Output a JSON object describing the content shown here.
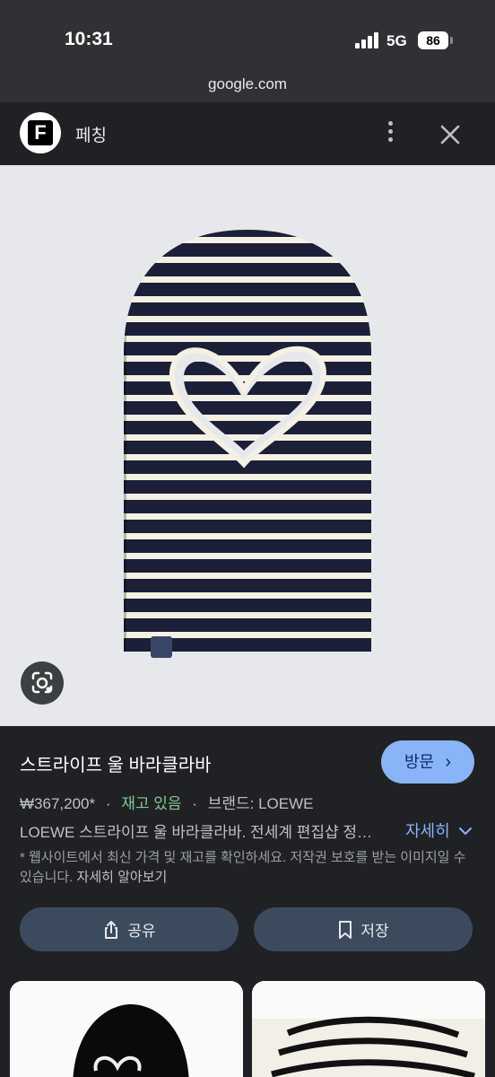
{
  "status_bar": {
    "time": "10:31",
    "network": "5G",
    "battery": "86"
  },
  "url_bar": {
    "domain": "google.com"
  },
  "header": {
    "site_logo_letter": "F",
    "site_name": "페칭"
  },
  "product": {
    "title": "스트라이프 울 바라클라바",
    "visit_label": "방문",
    "price": "₩367,200*",
    "stock": "재고 있음",
    "brand": "브랜드: LOEWE",
    "description": "LOEWE 스트라이프 울 바라클라바. 전세계 편집샵 정…",
    "more_label": "자세히",
    "notice": "* 웹사이트에서 최신 가격 및 재고를 확인하세요. 저작권 보호를 받는 이미지일 수 있습니다.",
    "learn_more": "자세히 알아보기"
  },
  "actions": {
    "share_label": "공유",
    "save_label": "저장"
  },
  "icons": [
    "more-vert-icon",
    "close-icon",
    "google-lens-icon",
    "chevron-right-icon",
    "chevron-down-icon",
    "share-icon",
    "bookmark-icon"
  ],
  "colors": {
    "accent": "#8ab4f8",
    "stock_green": "#81c995",
    "background": "#202124"
  }
}
